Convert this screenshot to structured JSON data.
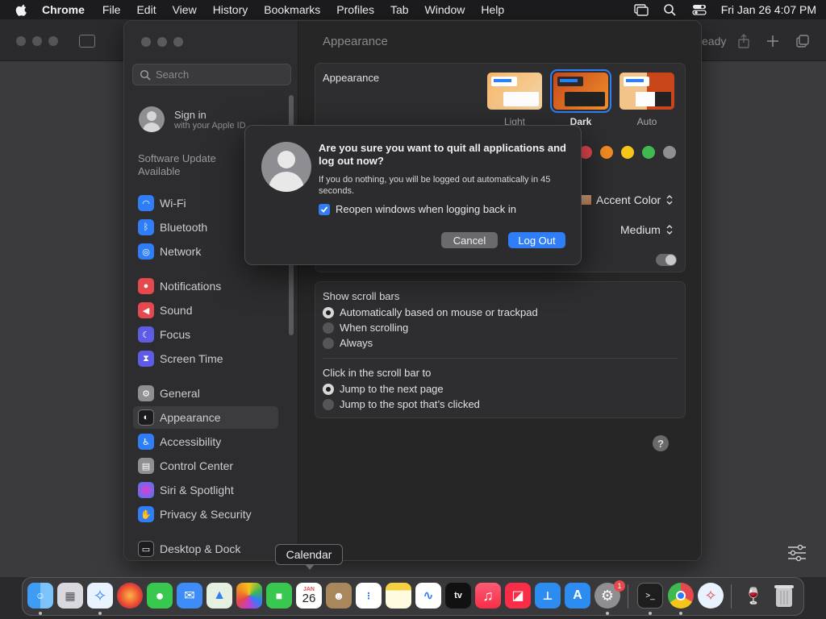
{
  "menubar": {
    "app": "Chrome",
    "items": [
      "File",
      "Edit",
      "View",
      "History",
      "Bookmarks",
      "Profiles",
      "Tab",
      "Window",
      "Help"
    ],
    "datetime": "Fri Jan 26  4:07 PM"
  },
  "browser": {
    "status_text": "eady"
  },
  "sidebar": {
    "search_placeholder": "Search",
    "signin_title": "Sign in",
    "signin_sub": "with your Apple ID",
    "software_update": "Software Update Available",
    "items": [
      {
        "label": "Wi-Fi",
        "icon": "wifi-icon",
        "color": "#2f7ef7"
      },
      {
        "label": "Bluetooth",
        "icon": "bluetooth-icon",
        "color": "#2f7ef7"
      },
      {
        "label": "Network",
        "icon": "globe-icon",
        "color": "#2f7ef7"
      },
      {
        "label": "Notifications",
        "icon": "bell-icon",
        "color": "#e5484d"
      },
      {
        "label": "Sound",
        "icon": "speaker-icon",
        "color": "#e5484d"
      },
      {
        "label": "Focus",
        "icon": "moon-icon",
        "color": "#5e5ce6"
      },
      {
        "label": "Screen Time",
        "icon": "hourglass-icon",
        "color": "#5e5ce6"
      },
      {
        "label": "General",
        "icon": "gear-icon",
        "color": "#8e8e93"
      },
      {
        "label": "Appearance",
        "icon": "appearance-icon",
        "color": "#1c1c1e"
      },
      {
        "label": "Accessibility",
        "icon": "accessibility-icon",
        "color": "#2f7ef7"
      },
      {
        "label": "Control Center",
        "icon": "control-center-icon",
        "color": "#8e8e93"
      },
      {
        "label": "Siri & Spotlight",
        "icon": "siri-icon",
        "color": "#c03dd6"
      },
      {
        "label": "Privacy & Security",
        "icon": "hand-icon",
        "color": "#2f7ef7"
      },
      {
        "label": "Desktop & Dock",
        "icon": "dock-icon",
        "color": "#1c1c1e"
      }
    ],
    "selected": "Appearance"
  },
  "main": {
    "title": "Appearance",
    "appearance_label": "Appearance",
    "modes": [
      "Light",
      "Dark",
      "Auto"
    ],
    "selected_mode": "Dark",
    "accent_colors": [
      "#e5484d",
      "#f08a24",
      "#f5c518",
      "#3fb950",
      "#8e8e93"
    ],
    "highlight_color_label": "Accent Color",
    "sidebar_icon_size": "Medium",
    "show_scroll_bars_label": "Show scroll bars",
    "scroll_options": [
      "Automatically based on mouse or trackpad",
      "When scrolling",
      "Always"
    ],
    "scroll_selected": 0,
    "click_scroll_label": "Click in the scroll bar to",
    "click_options": [
      "Jump to the next page",
      "Jump to the spot that’s clicked"
    ],
    "click_selected": 0,
    "help": "?"
  },
  "dialog": {
    "title": "Are you sure you want to quit all applications and log out now?",
    "message": "If you do nothing, you will be logged out automatically in 45 seconds.",
    "checkbox_label": "Reopen windows when logging back in",
    "checkbox_checked": true,
    "cancel_label": "Cancel",
    "logout_label": "Log Out"
  },
  "tooltip": {
    "text": "Calendar"
  },
  "dock": {
    "calendar_month": "JAN",
    "calendar_day": "26",
    "tv_label": "tv",
    "badge": "1"
  }
}
